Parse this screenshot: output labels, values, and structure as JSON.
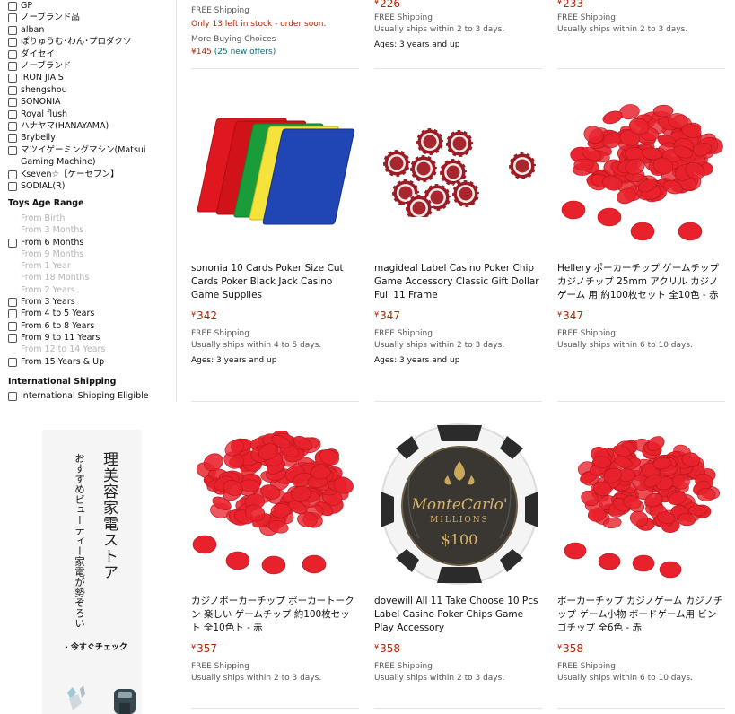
{
  "sidebar": {
    "brands": [
      "GP",
      "ノーブランド品",
      "alban",
      "ぽりゅうむ･わん･プロダクツ",
      "ダイセイ",
      "ノーブランド",
      "IRON JIA'S",
      "shengshou",
      "SONONIA",
      "Royal flush",
      "ハナヤマ(HANAYAMA)",
      "Brybelly",
      "マツイゲーミングマシン(Matsui Gaming Machine)",
      "Kseven☆【ケーセブン】",
      "SODIAL(R)"
    ],
    "age_title": "Toys Age Range",
    "ages": [
      {
        "label": "From Birth",
        "enabled": false
      },
      {
        "label": "From 3 Months",
        "enabled": false
      },
      {
        "label": "From 6 Months",
        "enabled": true
      },
      {
        "label": "From 9 Months",
        "enabled": false
      },
      {
        "label": "From 1 Year",
        "enabled": false
      },
      {
        "label": "From 18 Months",
        "enabled": false
      },
      {
        "label": "From 2 Years",
        "enabled": false
      },
      {
        "label": "From 3 Years",
        "enabled": true
      },
      {
        "label": "From 4 to 5 Years",
        "enabled": true
      },
      {
        "label": "From 6 to 8 Years",
        "enabled": true
      },
      {
        "label": "From 9 to 11 Years",
        "enabled": true
      },
      {
        "label": "From 12 to 14 Years",
        "enabled": false
      },
      {
        "label": "From 15 Years & Up",
        "enabled": true
      }
    ],
    "intl_title": "International Shipping",
    "intl_option": "International Shipping Eligible"
  },
  "ad": {
    "title": "理美容家電ストア",
    "subtitle": "おすすめビューティー家電が勢ぞろい",
    "cta": "› 今すぐチェック"
  },
  "top_row": [
    {
      "shipping": "FREE Shipping",
      "stock": "Only 13 left in stock - order soon.",
      "more_choices": "More Buying Choices",
      "offer_price": "¥145",
      "offer_count": "(25 new offers)"
    },
    {
      "price": "226",
      "shipping": "FREE Shipping",
      "delivery": "Usually ships within 2 to 3 days.",
      "ages": "Ages: 3 years and up"
    },
    {
      "price": "233",
      "shipping": "FREE Shipping",
      "delivery": "Usually ships within 2 to 3 days."
    }
  ],
  "products": [
    {
      "title": "sononia 10 Cards Poker Size Cut Cards Poker Black Jack Casino Game Supplies",
      "price_symbol": "¥",
      "price": "342",
      "shipping": "FREE Shipping",
      "delivery": "Usually ships within 4 to 5 days.",
      "ages": "Ages: 3 years and up"
    },
    {
      "title": "magideal Label Casino Poker Chip Game Accessory Classic Gift Dollar Full 11 Frame",
      "price_symbol": "¥",
      "price": "347",
      "shipping": "FREE Shipping",
      "delivery": "Usually ships within 2 to 3 days.",
      "ages": "Ages: 3 years and up"
    },
    {
      "title": "Hellery ポーカーチップ ゲームチップ カジノチップ 25mm アクリル カジノゲーム 用 約100枚セット 全10色 - 赤",
      "price_symbol": "¥",
      "price": "347",
      "shipping": "FREE Shipping",
      "delivery": "Usually ships within 6 to 10 days."
    },
    {
      "title": "カジノポーカーチップ ポーカートークン 楽しい ゲームチップ 約100枚セット 全10色ト - 赤",
      "price_symbol": "¥",
      "price": "357",
      "shipping": "FREE Shipping",
      "delivery": "Usually ships within 2 to 3 days."
    },
    {
      "title": "dovewill All 11 Take Choose 10 Pcs Label Casino Poker Chips Game Play Accessory",
      "price_symbol": "¥",
      "price": "358",
      "shipping": "FREE Shipping",
      "delivery": "Usually ships within 2 to 3 days."
    },
    {
      "title": "ポーカーチップ カジノゲーム カジノチップ ゲーム小物 ボードゲーム用 ビンゴチップ 全6色 - 赤",
      "price_symbol": "¥",
      "price": "358",
      "shipping": "FREE Shipping",
      "delivery": "Usually ships within 6 to 10 days."
    }
  ],
  "chip_text": {
    "brand": "MonteCarlo'",
    "sub": "MILLIONS",
    "value": "$100"
  },
  "colors": {
    "price": "#b12704",
    "link": "#007185",
    "muted": "#565959",
    "chip_red": "#e8222c"
  }
}
